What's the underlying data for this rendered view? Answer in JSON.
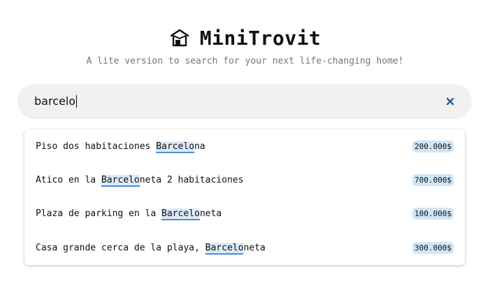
{
  "header": {
    "logo_icon": "house-box-icon",
    "title": "MiniTrovit",
    "subtitle": "A lite version to search for your next life-changing home!"
  },
  "search": {
    "value": "barcelo",
    "clear_icon": "close-icon",
    "accent_color": "#2f5a92"
  },
  "results": [
    {
      "before": "Piso dos habitaciones ",
      "match": "Barcelo",
      "after": "na",
      "price": "200.000$"
    },
    {
      "before": "Atico en la ",
      "match": "Barcelo",
      "after": "neta 2 habitaciones",
      "price": "700.000$"
    },
    {
      "before": "Plaza de parking en la ",
      "match": "Barcelo",
      "after": "neta",
      "price": "100.000$"
    },
    {
      "before": "Casa grande cerca de la playa, ",
      "match": "Barcelo",
      "after": "neta",
      "price": "300.000$"
    }
  ],
  "colors": {
    "highlight_bg": "#dbeaf8",
    "highlight_underline": "#4a90d0",
    "price_badge_bg": "#cfe6f7"
  }
}
